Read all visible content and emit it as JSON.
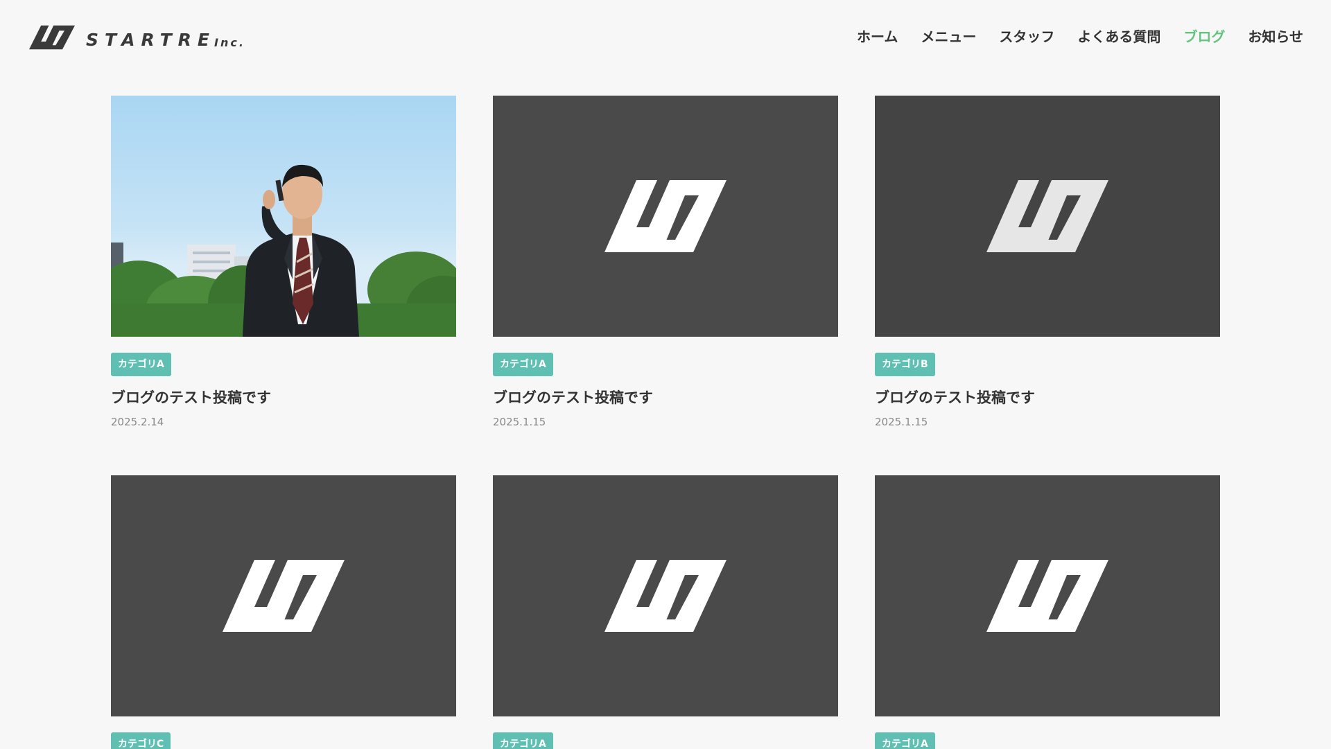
{
  "header": {
    "logo_text": "STARTRE",
    "logo_suffix": "Inc.",
    "nav": [
      {
        "label": "ホーム",
        "active": false
      },
      {
        "label": "メニュー",
        "active": false
      },
      {
        "label": "スタッフ",
        "active": false
      },
      {
        "label": "よくある質問",
        "active": false
      },
      {
        "label": "ブログ",
        "active": true
      },
      {
        "label": "お知らせ",
        "active": false
      }
    ]
  },
  "colors": {
    "accent": "#62c47e",
    "badge": "#5ebfb2",
    "placeholder_bg": "#4a4a4a",
    "background": "#f7f7f7"
  },
  "posts": [
    {
      "category": "カテゴリA",
      "title": "ブログのテスト投稿です",
      "date": "2025.2.14",
      "thumbnail": "photo-businessman"
    },
    {
      "category": "カテゴリA",
      "title": "ブログのテスト投稿です",
      "date": "2025.1.15",
      "thumbnail": "logo-placeholder"
    },
    {
      "category": "カテゴリB",
      "title": "ブログのテスト投稿です",
      "date": "2025.1.15",
      "thumbnail": "logo-placeholder"
    },
    {
      "category": "カテゴリC",
      "title": "",
      "date": "",
      "thumbnail": "logo-placeholder"
    },
    {
      "category": "カテゴリA",
      "title": "",
      "date": "",
      "thumbnail": "logo-placeholder"
    },
    {
      "category": "カテゴリA",
      "title": "",
      "date": "",
      "thumbnail": "logo-placeholder"
    }
  ]
}
